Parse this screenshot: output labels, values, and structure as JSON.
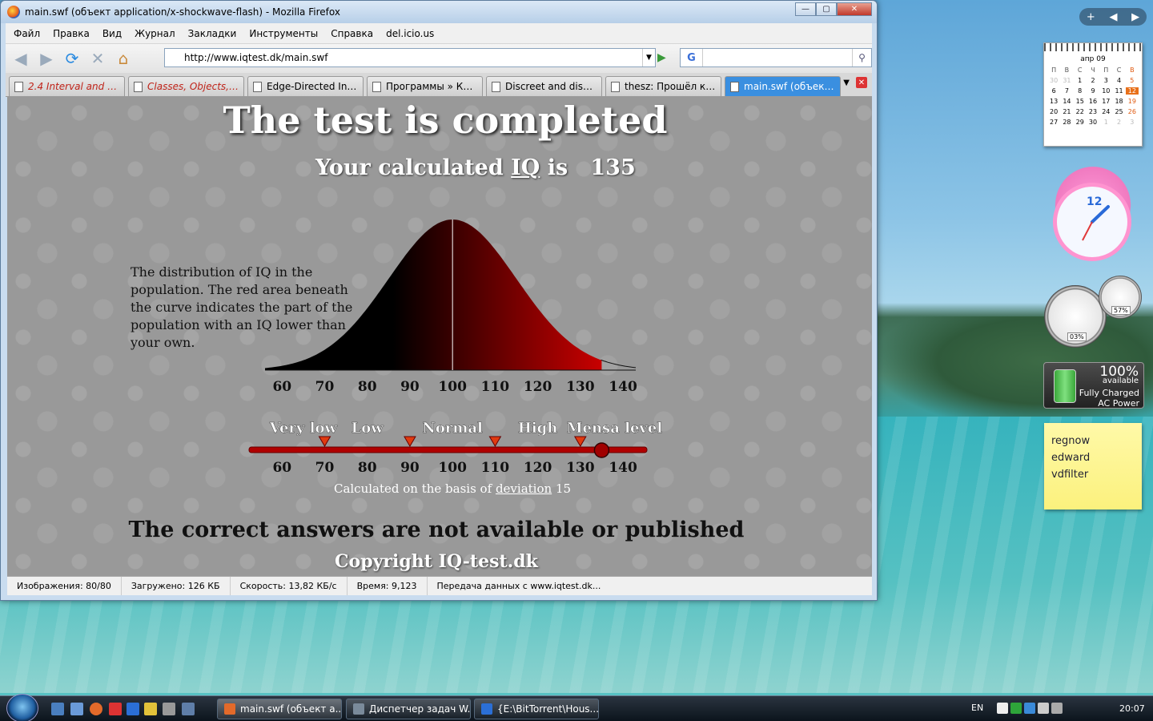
{
  "window": {
    "title": "main.swf (объект application/x-shockwave-flash) - Mozilla Firefox",
    "minimize": "—",
    "maximize": "▢",
    "close": "✕"
  },
  "menu": [
    "Файл",
    "Правка",
    "Вид",
    "Журнал",
    "Закладки",
    "Инструменты",
    "Справка",
    "del.icio.us"
  ],
  "toolbar": {
    "url": "http://www.iqtest.dk/main.swf",
    "search_engine": "G",
    "back_icon": "back-arrow-icon",
    "forward_icon": "forward-arrow-icon"
  },
  "tabs": [
    {
      "label": "2.4 Interval and Do...",
      "style": "red"
    },
    {
      "label": "Classes, Objects, a...",
      "style": "red"
    },
    {
      "label": "Edge-Directed Inte...",
      "style": "normal"
    },
    {
      "label": "Программы » Клу...",
      "style": "normal"
    },
    {
      "label": "Discreet and discre...",
      "style": "normal"
    },
    {
      "label": "thesz: Прошёл ку...",
      "style": "normal"
    },
    {
      "label": "main.swf (объект...",
      "style": "active"
    }
  ],
  "flash": {
    "title": "The test is completed",
    "subtitle_prefix": "Your calculated",
    "subtitle_iq": "IQ",
    "subtitle_is": "is",
    "score": "135",
    "description": "The distribution of IQ in the population. The red area beneath the curve indicates the part of the population with an IQ lower than your own.",
    "basis_prefix": "Calculated on the basis of",
    "basis_link": "deviation",
    "basis_value": "15",
    "footer_note": "The correct answers are not available or published",
    "copyright": "Copyright IQ-test.dk"
  },
  "chart_data": {
    "type": "area",
    "title": "",
    "description": "Normal distribution of IQ, mean 100, deviation 15; area shaded up to score 135",
    "x_ticks": [
      60,
      70,
      80,
      90,
      100,
      110,
      120,
      130,
      140
    ],
    "xlim": [
      56,
      143
    ],
    "mean": 100,
    "deviation": 15,
    "score": 135,
    "mean_line": 100,
    "colors": {
      "dark": "#000000",
      "red": "#c80000"
    },
    "scale": {
      "categories": [
        "Very low",
        "Low",
        "Normal",
        "High",
        "Mensa level"
      ],
      "category_centers": [
        65,
        80,
        100,
        120,
        138
      ],
      "boundaries": [
        70,
        90,
        110,
        130
      ],
      "ticks": [
        60,
        70,
        80,
        90,
        100,
        110,
        120,
        130,
        140
      ],
      "marker_value": 135
    }
  },
  "statusbar": {
    "images": "Изображения: 80/80",
    "loaded": "Загружено: 126 КБ",
    "speed": "Скорость: 13,82 КБ/с",
    "time": "Время: 9,123",
    "transfer": "Передача данных с www.iqtest.dk..."
  },
  "gadgets": {
    "calendar": {
      "month": "апр 09",
      "weekdays": [
        "П",
        "В",
        "С",
        "Ч",
        "П",
        "С",
        "В"
      ],
      "weeks": [
        [
          "30",
          "31",
          "1",
          "2",
          "3",
          "4",
          "5"
        ],
        [
          "6",
          "7",
          "8",
          "9",
          "10",
          "11",
          "12"
        ],
        [
          "13",
          "14",
          "15",
          "16",
          "17",
          "18",
          "19"
        ],
        [
          "20",
          "21",
          "22",
          "23",
          "24",
          "25",
          "26"
        ],
        [
          "27",
          "28",
          "29",
          "30",
          "1",
          "2",
          "3"
        ]
      ],
      "today": "12"
    },
    "clock_label": "12",
    "cpu": "03%",
    "memory": "57%",
    "battery": {
      "percent": "100%",
      "available": "available",
      "line1": "Fully Charged",
      "line2": "AC Power"
    },
    "note": [
      "regnow",
      "edward",
      "vdfilter"
    ]
  },
  "taskbar": {
    "buttons": [
      {
        "label": "main.swf (объект a...",
        "active": true
      },
      {
        "label": "Диспетчер задач W...",
        "active": false
      },
      {
        "label": "{E:\\BitTorrent\\Hous...",
        "active": false
      }
    ],
    "lang": "EN",
    "time": "20:07"
  },
  "sidebar_controls": [
    "+",
    "◀",
    "▶"
  ]
}
